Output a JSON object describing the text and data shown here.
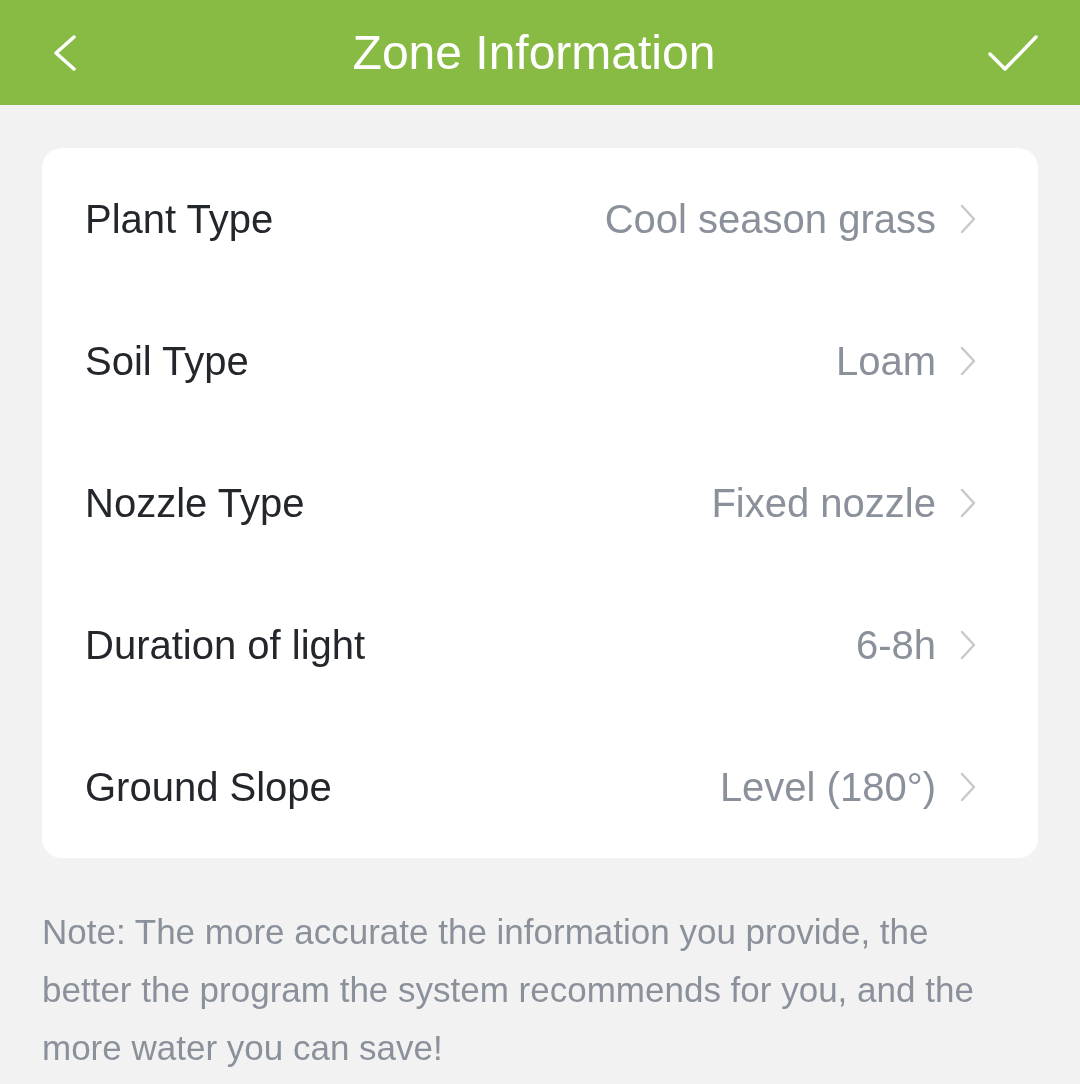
{
  "header": {
    "title": "Zone Information"
  },
  "rows": [
    {
      "label": "Plant Type",
      "value": "Cool season grass"
    },
    {
      "label": "Soil Type",
      "value": "Loam"
    },
    {
      "label": "Nozzle Type",
      "value": "Fixed nozzle"
    },
    {
      "label": "Duration of light",
      "value": "6-8h"
    },
    {
      "label": "Ground Slope",
      "value": "Level (180°)"
    }
  ],
  "note": "Note: The more accurate the information you provide, the better the program the system recommends for you, and the more water you can save!"
}
